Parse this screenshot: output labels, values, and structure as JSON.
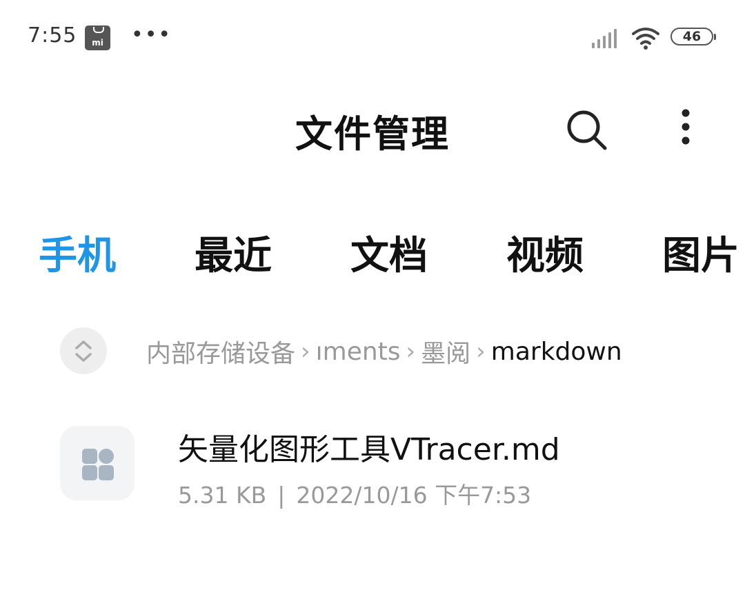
{
  "status_bar": {
    "time": "7:55",
    "app_icon": "mi-store-icon",
    "more": "•••",
    "battery": "46"
  },
  "header": {
    "title": "文件管理",
    "search_icon": "search-icon",
    "menu_icon": "more-vertical-icon"
  },
  "tabs": [
    {
      "label": "手机",
      "active": true
    },
    {
      "label": "最近",
      "active": false
    },
    {
      "label": "文档",
      "active": false
    },
    {
      "label": "视频",
      "active": false
    },
    {
      "label": "图片",
      "active": false
    }
  ],
  "breadcrumb": {
    "items": [
      "内部存储设备",
      "ıments",
      "墨阅"
    ],
    "current": "markdown",
    "toggle_icon": "expand-collapse-icon"
  },
  "files": [
    {
      "name": "矢量化图形工具VTracer.md",
      "size": "5.31 KB",
      "divider": "|",
      "modified": "2022/10/16 下午7:53",
      "icon": "file-grid-icon"
    }
  ],
  "colors": {
    "accent": "#1e95e6",
    "text_primary": "#111111",
    "text_secondary": "#999999",
    "icon_bg": "#f2f4f6",
    "icon_fg": "#a7b6c2"
  }
}
